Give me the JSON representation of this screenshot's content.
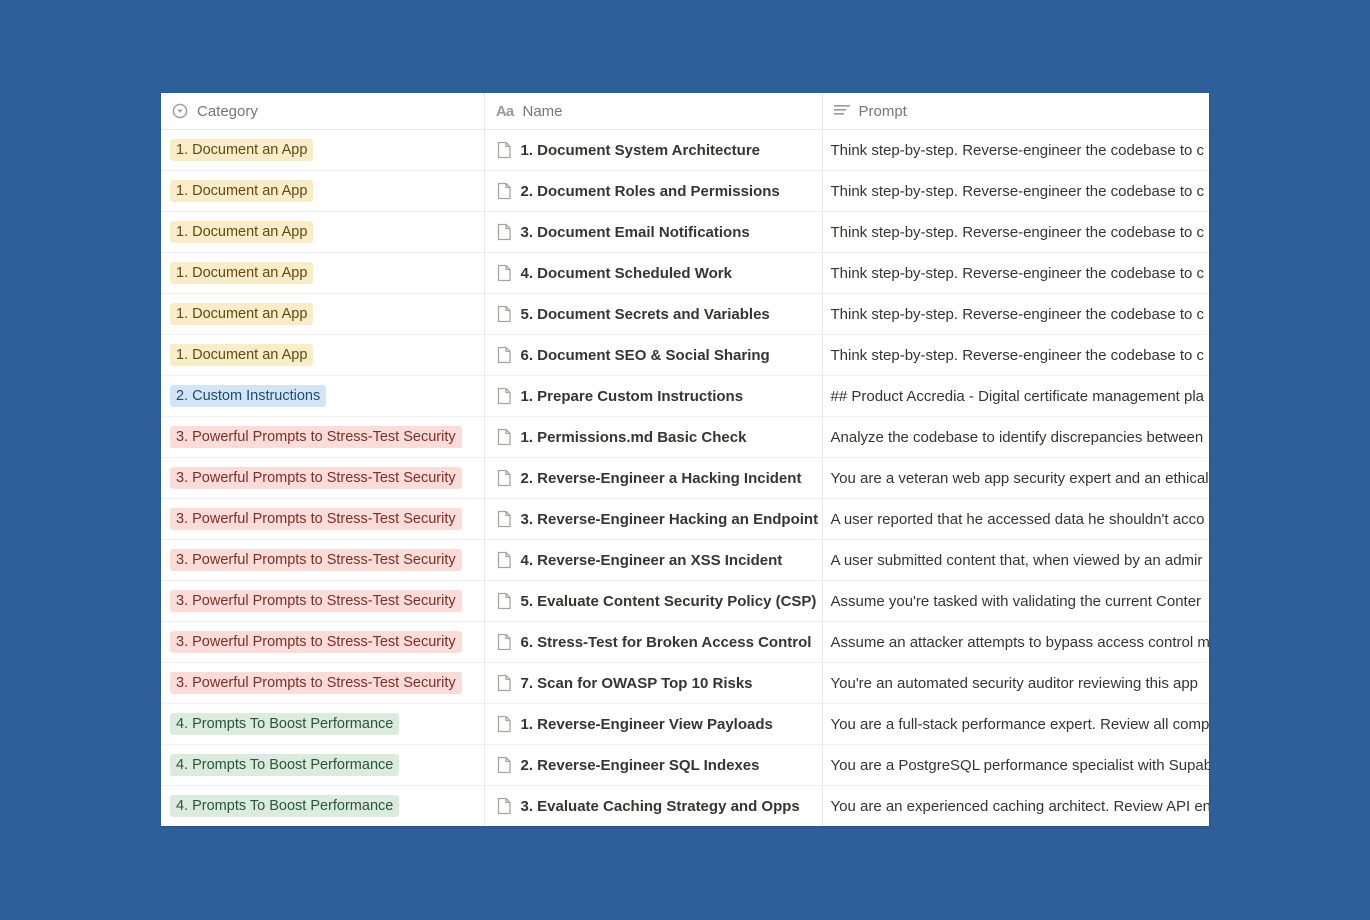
{
  "colors": {
    "background": "#2e5f99",
    "tag_document": {
      "bg": "#f9ecc8",
      "fg": "#5f4b14"
    },
    "tag_custom": {
      "bg": "#d3e5f5",
      "fg": "#1f4a6e"
    },
    "tag_security": {
      "bg": "#fbdcd8",
      "fg": "#7d2f29"
    },
    "tag_performance": {
      "bg": "#dcebdf",
      "fg": "#2b5538"
    }
  },
  "header": {
    "category": {
      "label": "Category",
      "icon": "select-property-icon"
    },
    "name": {
      "label": "Name",
      "icon": "title-property-icon"
    },
    "prompt": {
      "label": "Prompt",
      "icon": "text-property-icon"
    }
  },
  "rows": [
    {
      "category": "1. Document an App",
      "tag": "tag_document",
      "name": "1. Document System Architecture",
      "prompt": "Think step-by-step. Reverse-engineer the codebase to c"
    },
    {
      "category": "1. Document an App",
      "tag": "tag_document",
      "name": "2. Document Roles and Permissions",
      "prompt": "Think step-by-step. Reverse-engineer the codebase to c"
    },
    {
      "category": "1. Document an App",
      "tag": "tag_document",
      "name": "3. Document Email Notifications",
      "prompt": "Think step-by-step. Reverse-engineer the codebase to c"
    },
    {
      "category": "1. Document an App",
      "tag": "tag_document",
      "name": "4. Document Scheduled Work",
      "prompt": "Think step-by-step. Reverse-engineer the codebase to c"
    },
    {
      "category": "1. Document an App",
      "tag": "tag_document",
      "name": "5. Document Secrets and Variables",
      "prompt": "Think step-by-step. Reverse-engineer the codebase to c"
    },
    {
      "category": "1. Document an App",
      "tag": "tag_document",
      "name": "6. Document SEO & Social Sharing",
      "prompt": "Think step-by-step. Reverse-engineer the codebase to c"
    },
    {
      "category": "2. Custom Instructions",
      "tag": "tag_custom",
      "name": "1. Prepare Custom Instructions",
      "prompt": "## Product Accredia - Digital certificate management pla"
    },
    {
      "category": "3. Powerful Prompts to Stress-Test Security",
      "tag": "tag_security",
      "name": "1. Permissions.md Basic Check",
      "prompt": "Analyze the codebase to identify discrepancies between"
    },
    {
      "category": "3. Powerful Prompts to Stress-Test Security",
      "tag": "tag_security",
      "name": "2. Reverse-Engineer a Hacking Incident",
      "prompt": "You are a veteran web app security expert and an ethical"
    },
    {
      "category": "3. Powerful Prompts to Stress-Test Security",
      "tag": "tag_security",
      "name": "3. Reverse-Engineer Hacking an Endpoint",
      "prompt": "A user reported that he accessed data he shouldn't acco"
    },
    {
      "category": "3. Powerful Prompts to Stress-Test Security",
      "tag": "tag_security",
      "name": "4. Reverse-Engineer an XSS Incident",
      "prompt": "A user submitted content that, when viewed by an admir"
    },
    {
      "category": "3. Powerful Prompts to Stress-Test Security",
      "tag": "tag_security",
      "name": "5. Evaluate Content Security Policy (CSP)",
      "prompt": "Assume you're tasked with validating the current Conter"
    },
    {
      "category": "3. Powerful Prompts to Stress-Test Security",
      "tag": "tag_security",
      "name": "6. Stress-Test for Broken Access Control",
      "prompt": "Assume an attacker attempts to bypass access control m"
    },
    {
      "category": "3. Powerful Prompts to Stress-Test Security",
      "tag": "tag_security",
      "name": "7. Scan for OWASP Top 10 Risks",
      "prompt": "You're an automated security auditor reviewing this app"
    },
    {
      "category": "4. Prompts To Boost Performance",
      "tag": "tag_performance",
      "name": "1. Reverse-Engineer View Payloads",
      "prompt": "You are a full-stack performance expert. Review all comp"
    },
    {
      "category": "4. Prompts To Boost Performance",
      "tag": "tag_performance",
      "name": "2. Reverse-Engineer SQL Indexes",
      "prompt": "You are a PostgreSQL performance specialist with Supab"
    },
    {
      "category": "4. Prompts To Boost Performance",
      "tag": "tag_performance",
      "name": "3. Evaluate Caching Strategy and Opps",
      "prompt": "You are an experienced caching architect. Review API enc"
    }
  ]
}
